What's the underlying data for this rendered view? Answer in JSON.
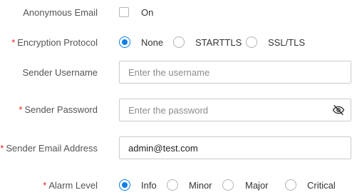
{
  "anonymous_email": {
    "label": "Anonymous Email",
    "checkbox_label": "On",
    "checked": false
  },
  "encryption_protocol": {
    "label": "Encryption Protocol",
    "required": true,
    "options": [
      "None",
      "STARTTLS",
      "SSL/TLS"
    ],
    "selected": "None"
  },
  "sender_username": {
    "label": "Sender Username",
    "required": false,
    "placeholder": "Enter the username",
    "value": ""
  },
  "sender_password": {
    "label": "Sender Password",
    "required": true,
    "placeholder": "Enter the password",
    "value": "",
    "toggle_icon": "eye-slash-icon"
  },
  "sender_email": {
    "label": "Sender Email Address",
    "required": true,
    "value": "admin@test.com"
  },
  "alarm_level": {
    "label": "Alarm Level",
    "required": true,
    "options": [
      "Info",
      "Minor",
      "Major",
      "Critical"
    ],
    "selected": "Info"
  },
  "colors": {
    "accent": "#0a7ee8",
    "required_star": "#e0241b"
  },
  "required_mark": "*"
}
